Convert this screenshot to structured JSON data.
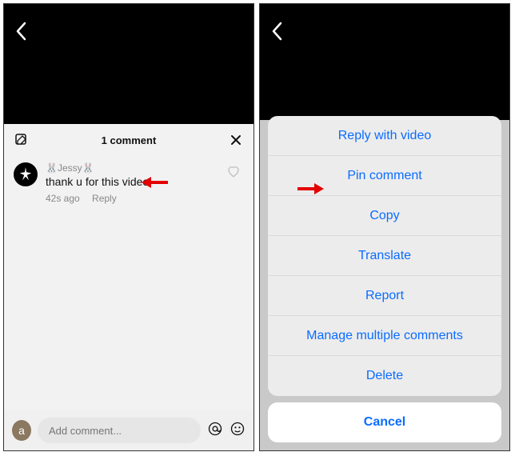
{
  "left": {
    "header": {
      "count_label": "1 comment"
    },
    "comment": {
      "username": "🐰Jessy🐰",
      "text_part1": "thank   u for this video.",
      "time": "42s ago",
      "reply_label": "Reply"
    },
    "compose": {
      "avatar_letter": "a",
      "placeholder": "Add comment..."
    }
  },
  "right": {
    "actions": [
      "Reply with video",
      "Pin comment",
      "Copy",
      "Translate",
      "Report",
      "Manage multiple comments",
      "Delete"
    ],
    "cancel": "Cancel"
  },
  "colors": {
    "accent": "#0a6cff",
    "arrow": "#e30000"
  }
}
